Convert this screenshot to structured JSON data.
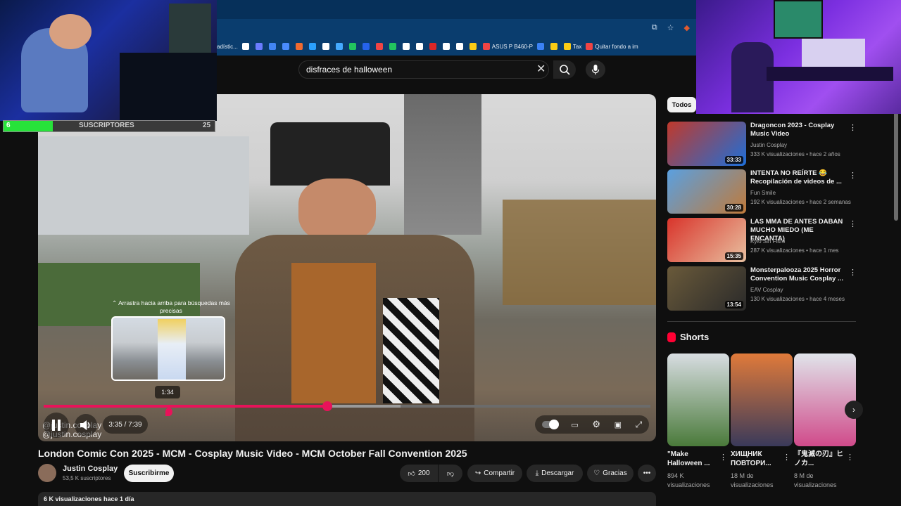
{
  "browser": {
    "bookmarks": [
      {
        "label": "adístic...",
        "color": "#0a3d6e"
      },
      {
        "label": "",
        "color": "#ffffff"
      },
      {
        "label": "",
        "color": "#6a7cff"
      },
      {
        "label": "",
        "color": "#4285f4"
      },
      {
        "label": "",
        "color": "#4a8cff"
      },
      {
        "label": "",
        "color": "#f06a30"
      },
      {
        "label": "",
        "color": "#2aa0ff"
      },
      {
        "label": "",
        "color": "#ffffff"
      },
      {
        "label": "",
        "color": "#44aaff"
      },
      {
        "label": "",
        "color": "#22c55e"
      },
      {
        "label": "",
        "color": "#2563eb"
      },
      {
        "label": "",
        "color": "#ef4444"
      },
      {
        "label": "",
        "color": "#22c55e"
      },
      {
        "label": "",
        "color": "#ffffff"
      },
      {
        "label": "",
        "color": "#ffffff"
      },
      {
        "label": "",
        "color": "#dc2626"
      },
      {
        "label": "",
        "color": "#ffffff"
      },
      {
        "label": "",
        "color": "#ffffff"
      },
      {
        "label": "",
        "color": "#facc15"
      },
      {
        "label": "ASUS P B460-P",
        "color": "#ef4444"
      },
      {
        "label": "",
        "color": "#3b82f6"
      },
      {
        "label": "",
        "color": "#facc15"
      },
      {
        "label": "Tax",
        "color": "#facc15"
      },
      {
        "label": "Quitar fondo a im",
        "color": "#ef4444"
      }
    ]
  },
  "search": {
    "query": "disfraces de halloween"
  },
  "overlay": {
    "subscriber_count_left": "6",
    "subscriber_label": "SUSCRIPTORES",
    "subscriber_goal": "25"
  },
  "player": {
    "watermark1": "@justin.cosplay",
    "watermark2": "@justin.cosplay",
    "preview_hint": "⌃ Arrastra hacia arriba para búsquedas más precisas",
    "preview_time": "1:34",
    "time": "3:35 / 7:39",
    "progress": 0.468,
    "buffered": 0.588
  },
  "video": {
    "title": "London Comic Con 2025 - MCM - Cosplay Music Video - MCM October Fall Convention 2025",
    "channel": "Justin Cosplay",
    "subscribers": "53,5 K suscriptores",
    "subscribe_label": "Suscribirme",
    "likes": "200",
    "share_label": "Compartir",
    "download_label": "Descargar",
    "thanks_label": "Gracias",
    "views": "6 K visualizaciones  hace 1 día"
  },
  "sidebar": {
    "chip": "Todos",
    "recommendations": [
      {
        "title": "Dragoncon 2023 - Cosplay Music Video",
        "channel": "Justin Cosplay",
        "meta": "333 K visualizaciones • hace 2 años",
        "duration": "33:33",
        "c1": "#c0392b",
        "c2": "#1e6fd9"
      },
      {
        "title": "INTENTA NO REÍRTE 😂 Recopilación de videos de ...",
        "channel": "Fun Smile",
        "meta": "192 K visualizaciones • hace 2 semanas",
        "duration": "30:28",
        "c1": "#5aa0e0",
        "c2": "#c07a3a"
      },
      {
        "title": "LAS MMA DE ANTES DABAN MUCHO MIEDO (ME ENCANTA)",
        "channel": "Kylo Sin Filtro",
        "meta": "287 K visualizaciones • hace 1 mes",
        "duration": "15:35",
        "c1": "#d9342b",
        "c2": "#e8c0a0"
      },
      {
        "title": "Monsterpalooza 2025 Horror Convention Music Cosplay ...",
        "channel": "EAV Cosplay",
        "meta": "130 K visualizaciones • hace 4 meses",
        "duration": "13:54",
        "c1": "#6a5a3a",
        "c2": "#2a2a2a"
      }
    ],
    "shorts_label": "Shorts",
    "shorts": [
      {
        "title": "\"Make Halloween ...",
        "meta": "894 K visualizaciones",
        "c1": "#d8dde2",
        "c2": "#4a7a3a"
      },
      {
        "title": "ХИЩНИК ПОВТОРИ...",
        "meta": "18 M de visualizaciones",
        "c1": "#e07a3a",
        "c2": "#3a3a5a"
      },
      {
        "title": "『鬼滅の刃』ヒノカ...",
        "meta": "8 M de visualizaciones",
        "c1": "#e0e4ea",
        "c2": "#d04a8a"
      }
    ]
  }
}
